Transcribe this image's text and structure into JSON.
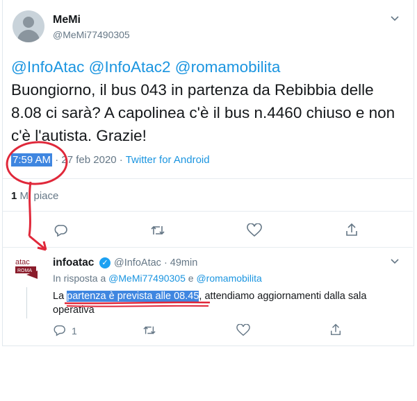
{
  "tweet": {
    "name": "MeMi",
    "handle": "@MeMi77490305",
    "mentions": "@InfoAtac @InfoAtac2 @romamobilita",
    "body": "Buongiorno, il bus 043 in partenza da Rebibbia delle 8.08 ci sarà? A capolinea c'è il bus n.4460 chiuso e non c'è l'autista. Grazie!",
    "time": "7:59 AM",
    "date": "· 27 feb 2020 ·",
    "client": "Twitter for Android",
    "like_count": "1",
    "like_label": "Mi piace"
  },
  "reply": {
    "logo_text": "atac",
    "logo_subtext": "ROMA",
    "name": "infoatac",
    "handle_time": "@InfoAtac · 49min",
    "reply_prefix": "In risposta a",
    "reply_user1": "@MeMi77490305",
    "reply_and": "e",
    "reply_user2": "@romamobilita",
    "text_prefix": "La ",
    "text_highlight": "partenza è prevista alle 08.45",
    "text_suffix": ", attendiamo aggiornamenti dalla sala operativa",
    "reply_count": "1"
  },
  "icons": {
    "chevron": "chevron-down-icon",
    "reply": "reply-icon",
    "retweet": "retweet-icon",
    "like": "heart-icon",
    "share": "share-icon",
    "verified": "verified-badge-icon"
  },
  "colors": {
    "link": "#1b95e0",
    "muted": "#657786",
    "highlight": "#3f86e0",
    "annotation": "#e0283a"
  }
}
